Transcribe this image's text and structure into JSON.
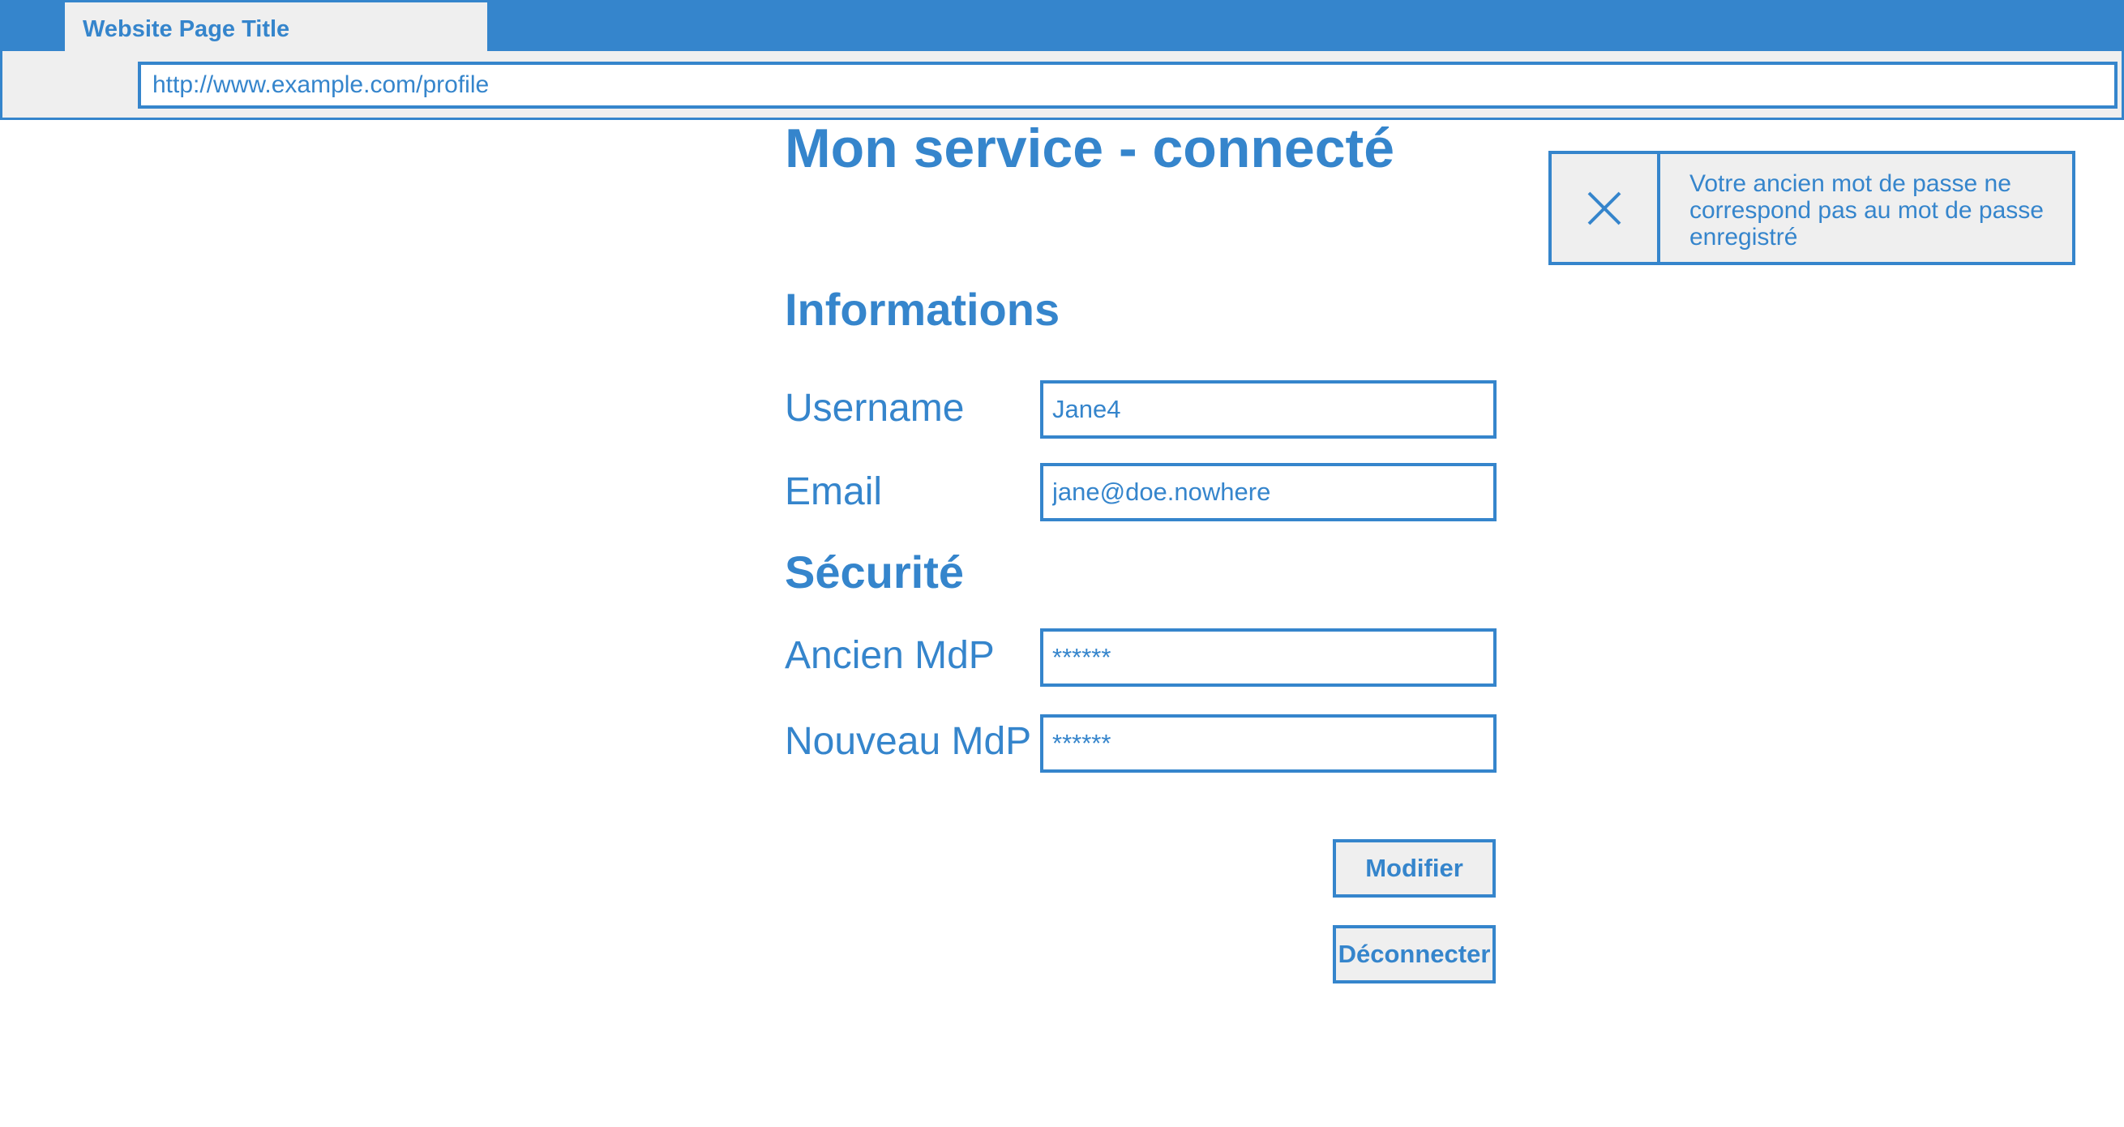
{
  "browser": {
    "tab_title": "Website Page Title",
    "url": "http://www.example.com/profile"
  },
  "page": {
    "title": "Mon service - connecté"
  },
  "informations": {
    "heading": "Informations",
    "username_label": "Username",
    "username_value": "Jane4",
    "email_label": "Email",
    "email_value": "jane@doe.nowhere"
  },
  "security": {
    "heading": "Sécurité",
    "old_password_label": "Ancien MdP",
    "old_password_value": "******",
    "new_password_label": "Nouveau MdP",
    "new_password_value": "******"
  },
  "actions": {
    "modify_label": "Modifier",
    "logout_label": "Déconnecter"
  },
  "notification": {
    "icon": "close-icon",
    "message": "Votre ancien mot de passe ne correspond pas au mot de passe enregistré"
  },
  "colors": {
    "accent": "#3585cc",
    "chrome_background": "#efefef",
    "background": "#ffffff"
  }
}
